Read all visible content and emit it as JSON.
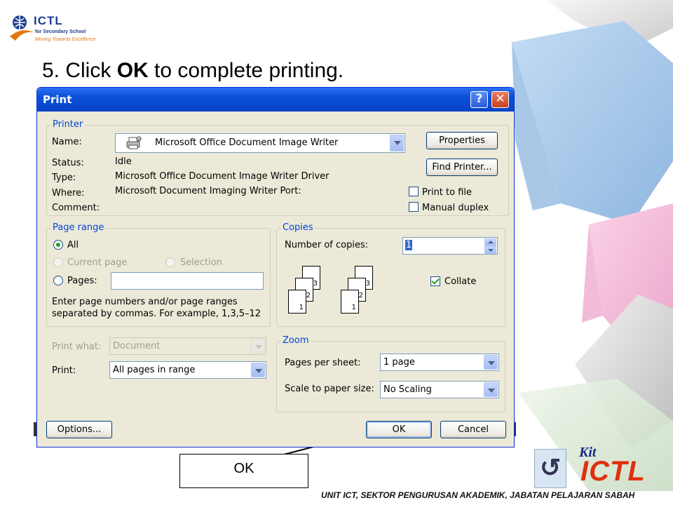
{
  "slide": {
    "logo": {
      "title": "ICTL",
      "line1": "for Secondary School",
      "line2": "Moving Towards Excellence"
    },
    "instruction_prefix": "5. Click ",
    "instruction_bold": "OK",
    "instruction_suffix": " to complete printing.",
    "callout_label": "OK",
    "footer": "UNIT ICT, SEKTOR PENGURUSAN AKADEMIK, JABATAN PELAJARAN SABAH",
    "kit_logo": {
      "word": "Kit",
      "brand": "ICTL"
    }
  },
  "dialog": {
    "title": "Print",
    "help_glyph": "?",
    "close_glyph": "✕",
    "printer": {
      "legend": "Printer",
      "name_label": "Name:",
      "name_value": "Microsoft Office Document Image Writer",
      "status_label": "Status:",
      "status_value": "Idle",
      "type_label": "Type:",
      "type_value": "Microsoft Office Document Image Writer Driver",
      "where_label": "Where:",
      "where_value": "Microsoft Document Imaging Writer Port:",
      "comment_label": "Comment:",
      "properties_button": "Properties",
      "find_printer_button": "Find Printer...",
      "print_to_file": "Print to file",
      "manual_duplex": "Manual duplex"
    },
    "page_range": {
      "legend": "Page range",
      "all": "All",
      "current_page": "Current page",
      "selection": "Selection",
      "pages": "Pages:",
      "pages_value": "",
      "hint_line1": "Enter page numbers and/or page ranges",
      "hint_line2": "separated by commas.  For example, 1,3,5–12"
    },
    "copies": {
      "legend": "Copies",
      "number_label": "Number of copies:",
      "number_value": "1",
      "collate": "Collate",
      "collate_checked": true,
      "stack_labels": [
        "1",
        "2",
        "3"
      ]
    },
    "print_what_label": "Print what:",
    "print_what_value": "Document",
    "print_label": "Print:",
    "print_value": "All pages in range",
    "zoom": {
      "legend": "Zoom",
      "pages_per_sheet_label": "Pages per sheet:",
      "pages_per_sheet_value": "1 page",
      "scale_label": "Scale to paper size:",
      "scale_value": "No Scaling"
    },
    "options_button": "Options...",
    "ok_button": "OK",
    "cancel_button": "Cancel"
  },
  "colors": {
    "titlebar": "#0a50d8",
    "dialog_bg": "#ece9d8",
    "group_label": "#0046d5",
    "check_green": "#21a121"
  }
}
